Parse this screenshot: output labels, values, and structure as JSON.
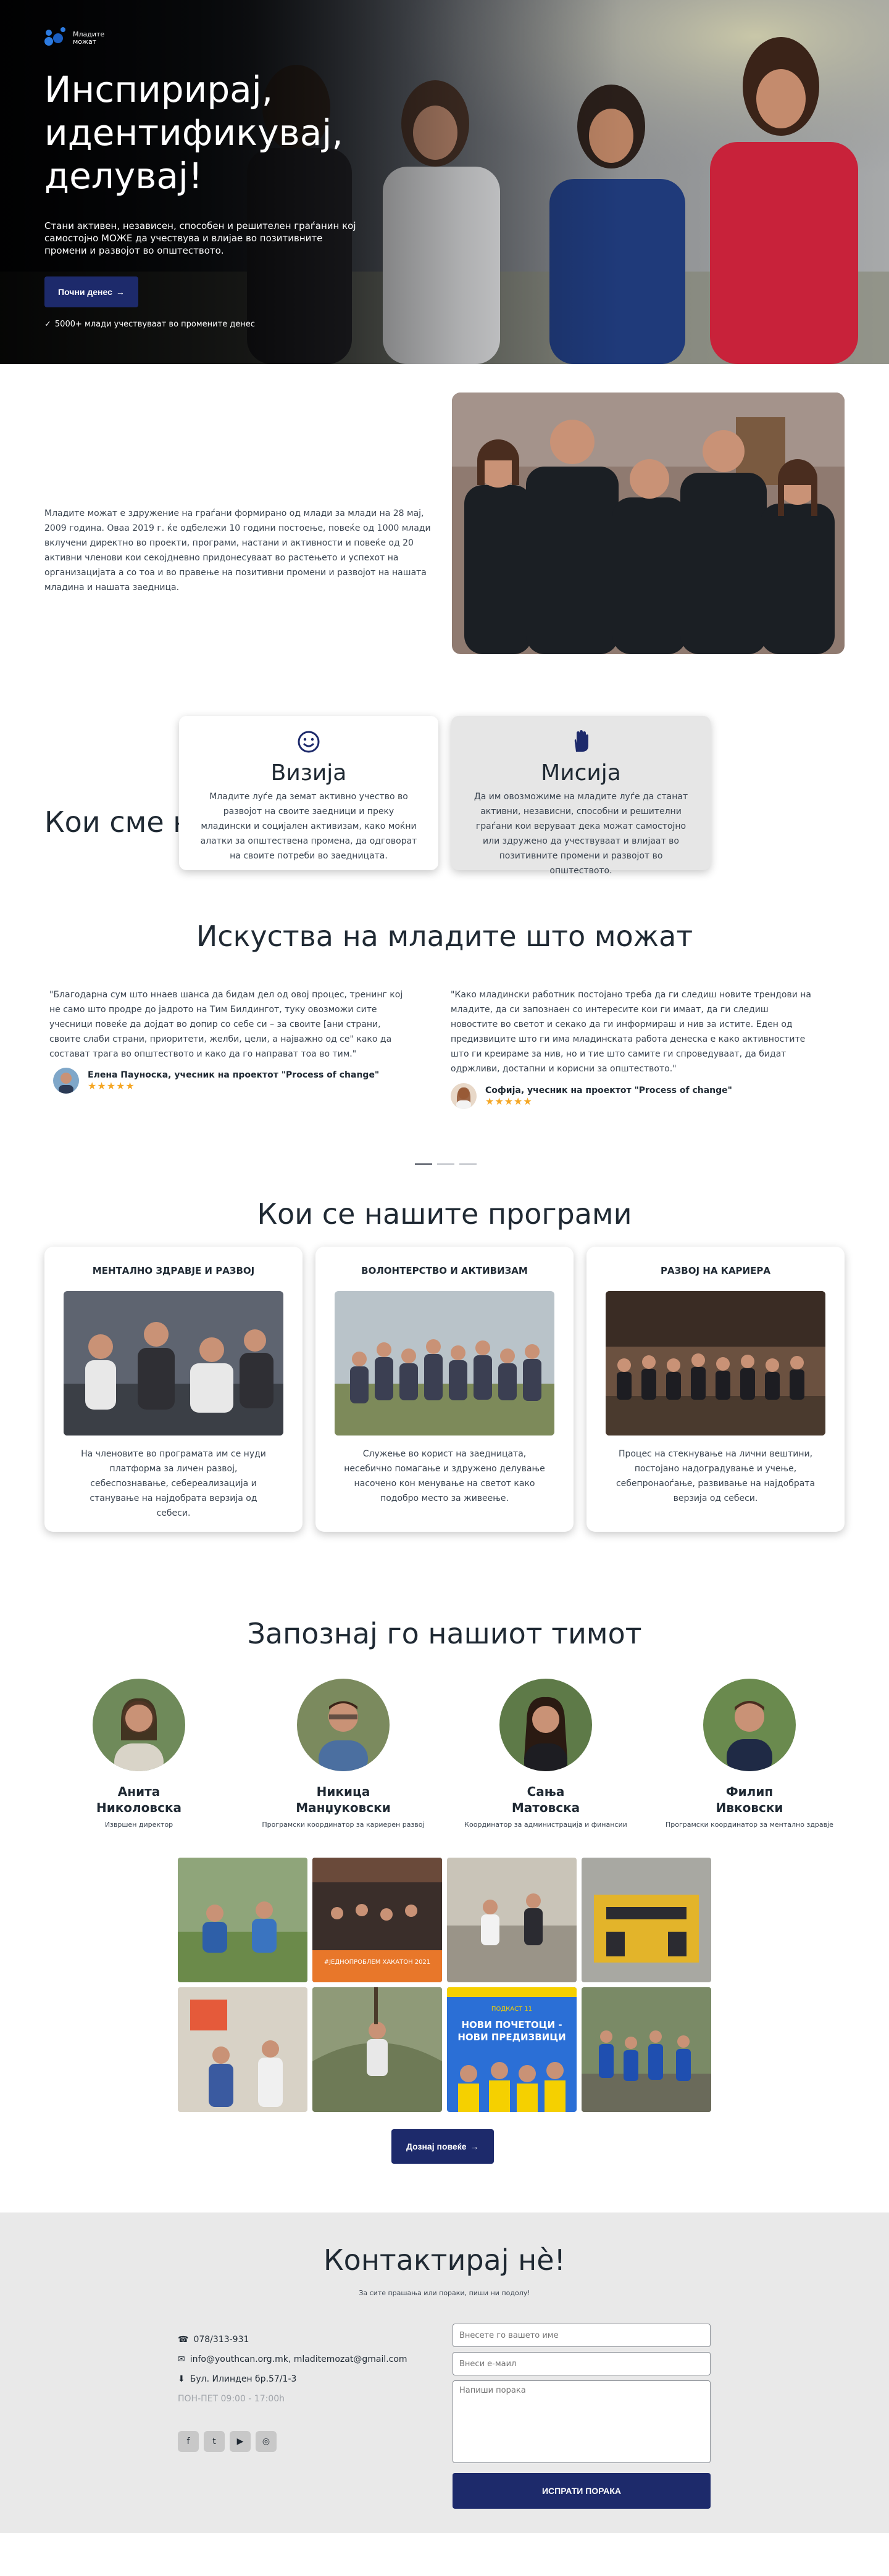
{
  "brand": {
    "name": "Младите можат",
    "accent": "#1d2a6b"
  },
  "hero": {
    "title": "Инспирирај, идентификувај, делувај!",
    "subtitle": "Стани активен, независен, способен и решителен граѓанин кој самостојно МОЖЕ да учествува и влијае во позитивните промени и развојот во општеството.",
    "cta": "Почни денес",
    "stat": "5000+ млади учествуваат во промените денес"
  },
  "about": {
    "title": "Кои сме ние?",
    "text": "Младите можат е здружение на граѓани формирано од млади за млади на 28 мај, 2009 година. Оваа 2019 г. ќе одбележи 10 години постоење, повеќе од 1000 млади вклучени директно во проекти, програми, настани и активности и повеќе од 20 активни членови кои секојдневно придонесуваат во растењето и успехот на организацијата а со тоа и во правење на позитивни промени и развојот на нашата младина и нашата заедница."
  },
  "vision": {
    "title": "Визија",
    "icon": "smile-icon",
    "text": "Младите луѓе да земат активно учество во развојот на своите заедници и преку младински и социјален активизам, како моќни алатки за општествена промена, да одговорат на своите потреби во заедницата."
  },
  "mission": {
    "title": "Мисија",
    "icon": "hand-icon",
    "text": "Да им овозможиме на младите луѓе да станат активни, независни, способни и решителни граѓани кои веруваат дека можат самостојно или здружено да учествуваат и влијаат во позитивните промени и развојот во општеството."
  },
  "testimonials": {
    "title": "Искуства на младите што можат",
    "items": [
      {
        "quote": "\"Благодарна сум што ннаев шанса да бидам дел од овој процес, тренинг кој не само што продре до јадрото на Тим Билдингот, туку овозможи сите учесници повеќе да дојдат во допир со себе си – за своите [ани страни, своите слаби страни, приоритети, желби, цели, а најважно од се\" како да состават трага во општеството и како да го направат тоа во тим.\"",
        "name": "Елена Пауноска, учесник на проектот \"Process of change\"",
        "stars": "★★★★★"
      },
      {
        "quote": "\"Како младински работник постојано треба да ги следиш новите трендови на младите, да си запознаен со интересите кои ги имаат, да ги следиш новостите во светот и секако да ги информираш и нив за истите. Еден од предизвиците што ги има младинската работа денеска е како активностите што ги креираме за нив, но и тие што самите ги спроведуваат, да бидат одржливи, достапни и корисни за општеството.\"",
        "name": "Софија, учесник на проектот \"Process of change\"",
        "stars": "★★★★★"
      }
    ]
  },
  "programs": {
    "title": "Кои се нашите програми",
    "items": [
      {
        "title": "МЕНТАЛНО ЗДРАВЈЕ И РАЗВОЈ",
        "text": "На членовите во програмата им се нуди платформа за личен развој, себеспознавање, себереализација и станување на најдобрата верзија од себеси."
      },
      {
        "title": "ВОЛОНТЕРСТВО И АКТИВИЗАМ",
        "text": "Служење во корист на заедницата, несебично помагање и здружено делување насочено кон менување на светот како подобро место за живеење."
      },
      {
        "title": "РАЗВОЈ НА КАРИЕРА",
        "text": "Процес на стекнување на лични вештини, постојано надоградување и учење, себепронаоѓање, развивање на најдобрата верзија од себеси."
      }
    ]
  },
  "team": {
    "title": "Запознај го нашиот тимот",
    "members": [
      {
        "first": "Анита",
        "last": "Николовска",
        "role": "Извршен директор"
      },
      {
        "first": "Никица",
        "last": "Манџуковски",
        "role": "Програмски координатор за кариерен развој"
      },
      {
        "first": "Сања",
        "last": "Матовска",
        "role": "Координатор за администрација и финансии"
      },
      {
        "first": "Филип",
        "last": "Ивковски",
        "role": "Програмски координатор за ментално здравје"
      }
    ]
  },
  "gallery": {
    "more": "Дознај повеќе",
    "hackathon_caption": "#ЈЕДНОПРОБЛЕМ ХАКАТОН 2021",
    "poster_lines": [
      "ПОДКАСТ 11",
      "НОВИ ПОЧЕТОЦИ -",
      "НОВИ ПРЕДИЗВИЦИ"
    ]
  },
  "contact": {
    "title": "Контактирај нè!",
    "subtitle": "За сите прашања или пораки, пиши ни подолу!",
    "phone": "078/313-931",
    "email": "info@youthcan.org.mk, mladitemozat@gmail.com",
    "address": "Бул. Илинден бр.57/1-3",
    "hours": "ПОН-ПЕТ 09:00 - 17:00h",
    "name_placeholder": "Внесете го вашето име",
    "email_placeholder": "Внеси е-маил",
    "message_placeholder": "Напиши порака",
    "send": "ИСПРАТИ ПОРАКА"
  }
}
